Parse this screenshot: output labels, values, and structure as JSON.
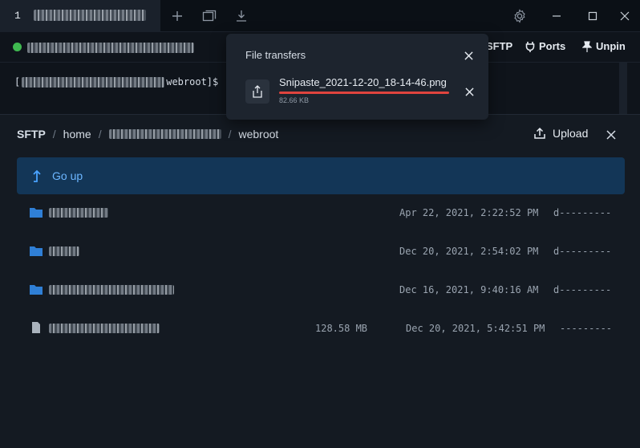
{
  "titlebar": {
    "tab_number": "1",
    "tab_title": "redacted host",
    "icons": [
      "plus-icon",
      "window-icon",
      "download-icon",
      "gear-icon"
    ]
  },
  "toolbar": {
    "host": "redacted connection",
    "sftp_label": "SFTP",
    "ports_label": "Ports",
    "unpin_label": "Unpin"
  },
  "terminal": {
    "prompt_prefix": "[",
    "prompt_suffix": " webroot]$"
  },
  "transfers": {
    "title": "File transfers",
    "file_name": "Snipaste_2021-12-20_18-14-46.png",
    "file_size": "82.66 KB",
    "progress": 1.0
  },
  "sftp": {
    "breadcrumb": {
      "root": "SFTP",
      "home": "home",
      "user": "redacted",
      "current": "webroot"
    },
    "upload_label": "Upload",
    "go_up_label": "Go up",
    "entries": [
      {
        "type": "folder",
        "name": "redacted",
        "size": "",
        "date": "Apr 22, 2021, 2:22:52 PM",
        "perm": "d---------"
      },
      {
        "type": "folder",
        "name": "redacted",
        "size": "",
        "date": "Dec 20, 2021, 2:54:02 PM",
        "perm": "d---------"
      },
      {
        "type": "folder",
        "name": "redacted",
        "size": "",
        "date": "Dec 16, 2021, 9:40:16 AM",
        "perm": "d---------"
      },
      {
        "type": "file",
        "name": "redacted",
        "size": "128.58 MB",
        "date": "Dec 20, 2021, 5:42:51 PM",
        "perm": "---------"
      }
    ]
  },
  "colors": {
    "accent": "#4aa3ff",
    "status_online": "#3fb950",
    "progress": "#e0443e",
    "go_up_bg": "#133657"
  }
}
